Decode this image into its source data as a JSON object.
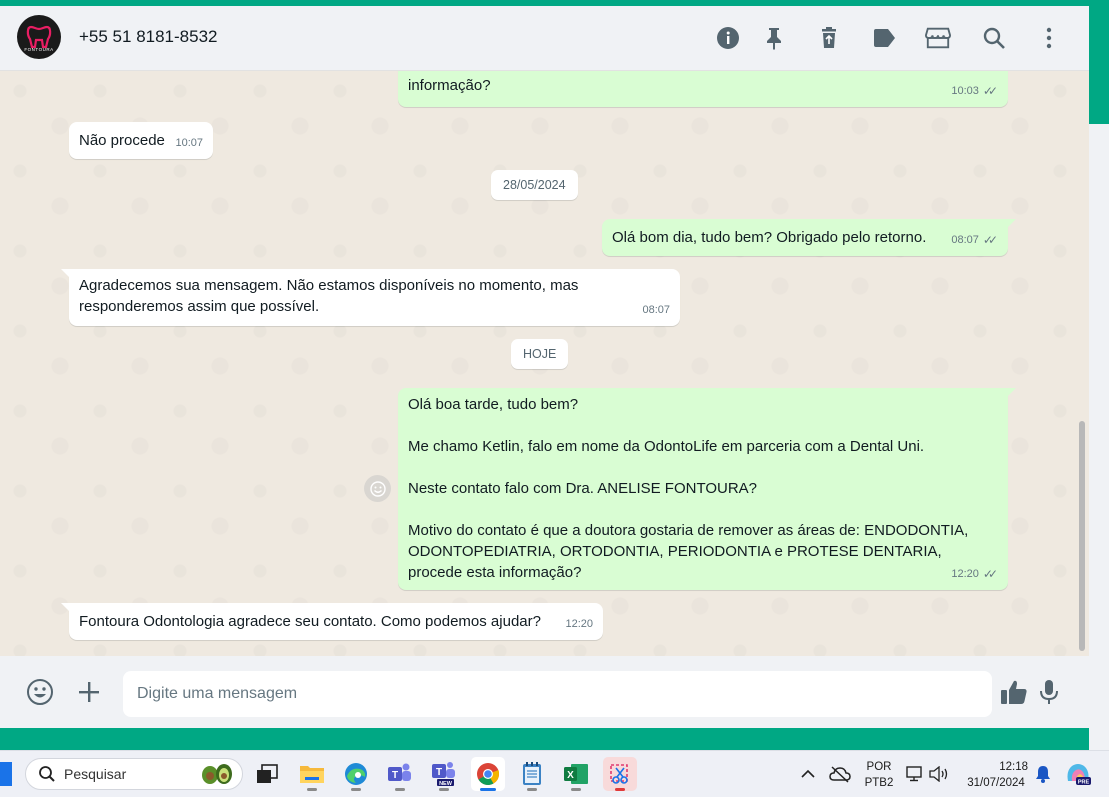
{
  "header": {
    "avatar_text": "FONTOURA",
    "contact_name": "+55 51 8181-8532",
    "icons": [
      "info-icon",
      "pin-icon",
      "delete-icon",
      "label-icon",
      "catalog-store-icon",
      "search-icon",
      "menu-dots-icon"
    ]
  },
  "messages": [
    {
      "dir": "out",
      "text": "informação?",
      "time": "10:03",
      "ticks": "✓✓"
    },
    {
      "dir": "in",
      "text": "Não procede",
      "time": "10:07"
    },
    {
      "type": "date",
      "text": "28/05/2024"
    },
    {
      "dir": "out",
      "text": "Olá bom dia, tudo bem? Obrigado pelo retorno.",
      "time": "08:07",
      "ticks": "✓✓"
    },
    {
      "dir": "in",
      "text": "Agradecemos sua mensagem. Não estamos disponíveis no momento, mas responderemos assim que possível.",
      "time": "08:07"
    },
    {
      "type": "date",
      "text": "HOJE"
    },
    {
      "dir": "out",
      "lines": [
        "Olá boa tarde, tudo bem?",
        "Me chamo Ketlin, falo em nome da OdontoLife em parceria com a Dental Uni.",
        "Neste contato falo com Dra.  ANELISE FONTOURA?",
        "Motivo do contato é que a doutora gostaria de remover as áreas de: ENDODONTIA, ODONTOPEDIATRIA, ORTODONTIA, PERIODONTIA e PROTESE DENTARIA, procede esta informação?"
      ],
      "time": "12:20",
      "ticks": "✓✓"
    },
    {
      "dir": "in",
      "text": "Fontoura Odontologia agradece seu contato. Como podemos ajudar?",
      "time": "12:20"
    }
  ],
  "composer": {
    "placeholder": "Digite uma mensagem"
  },
  "taskbar": {
    "search_label": "Pesquisar",
    "lang_top": "POR",
    "lang_bottom": "PTB2",
    "time": "12:18",
    "date": "31/07/2024",
    "apps": [
      "task-view",
      "file-explorer",
      "edge",
      "teams",
      "teams-new",
      "chrome",
      "notepad",
      "excel",
      "snipping-tool"
    ],
    "teams_new_badge": "NEW",
    "copilot_badge": "PRE"
  }
}
